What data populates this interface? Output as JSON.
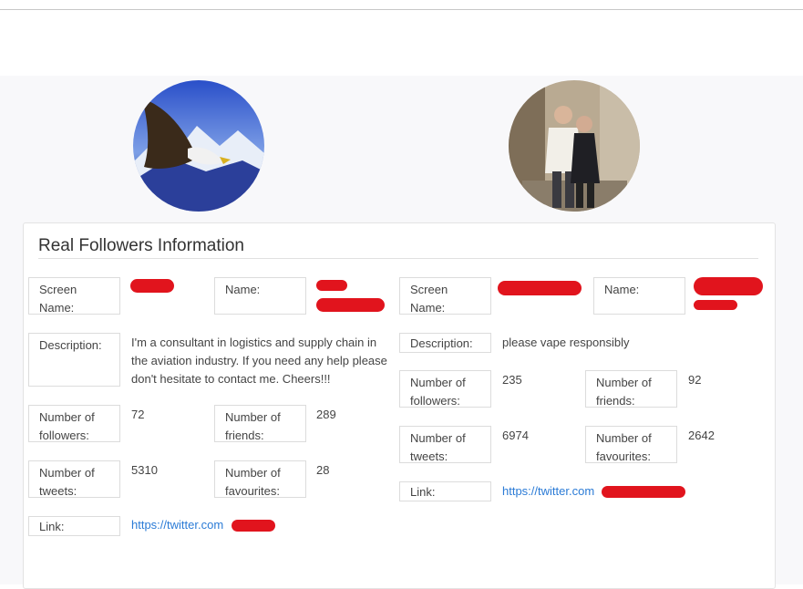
{
  "card": {
    "title": "Real Followers Information"
  },
  "left": {
    "labels": {
      "screen_name": "Screen Name:",
      "name": "Name:",
      "description": "Description:",
      "followers": "Number of followers:",
      "friends": "Number of friends:",
      "tweets": "Number of tweets:",
      "favourites": "Number of favourites:",
      "link": "Link:"
    },
    "description": "I'm a consultant in logistics and supply chain in the aviation industry. If you need any help please don't hesitate to contact me. Cheers!!!",
    "followers": "72",
    "friends": "289",
    "tweets": "5310",
    "favourites": "28",
    "link": "https://twitter.com"
  },
  "right": {
    "labels": {
      "screen_name": "Screen Name:",
      "name": "Name:",
      "description": "Description:",
      "followers": "Number of followers:",
      "friends": "Number of friends:",
      "tweets": "Number of tweets:",
      "favourites": "Number of favourites:",
      "link": "Link:"
    },
    "description": "please vape responsibly",
    "followers": "235",
    "friends": "92",
    "tweets": "6974",
    "favourites": "2642",
    "link": "https://twitter.com"
  },
  "colors": {
    "link": "#2b7bd6",
    "redaction": "#e1141d",
    "border": "#dcdcdc"
  }
}
